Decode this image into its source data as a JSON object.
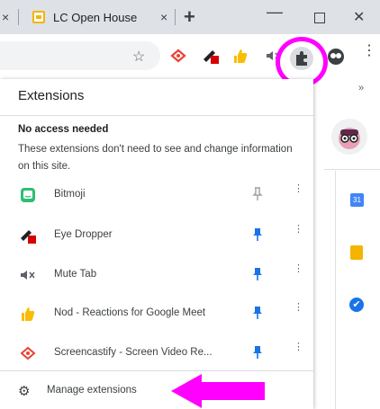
{
  "browser": {
    "tab_title": "LC Open House",
    "close_glyph": "×",
    "new_tab_glyph": "+",
    "minimize_glyph": "—",
    "window_close_glyph": "✕",
    "star_glyph": "☆",
    "menu_glyph": "⋮"
  },
  "panel": {
    "title": "Extensions",
    "section_title": "No access needed",
    "section_description": "These extensions don't need to see and change information on this site.",
    "extensions": [
      {
        "name": "Bitmoji",
        "icon": "bitmoji-icon",
        "pinned": false
      },
      {
        "name": "Eye Dropper",
        "icon": "eyedropper-icon",
        "pinned": true
      },
      {
        "name": "Mute Tab",
        "icon": "mute-icon",
        "pinned": true
      },
      {
        "name": "Nod - Reactions for Google Meet",
        "icon": "nod-icon",
        "pinned": true
      },
      {
        "name": "Screencastify - Screen Video Re...",
        "icon": "screencastify-icon",
        "pinned": true
      }
    ],
    "manage_label": "Manage extensions",
    "row_menu_glyph": "⋮",
    "gear_glyph": "⚙"
  },
  "page": {
    "close_glyph": "×",
    "chevron_glyph": "»",
    "calendar_label": "31",
    "tasks_glyph": "✔"
  },
  "colors": {
    "highlight": "#ff00ff",
    "pinned": "#1a73e8",
    "unpinned": "#9aa0a6"
  }
}
